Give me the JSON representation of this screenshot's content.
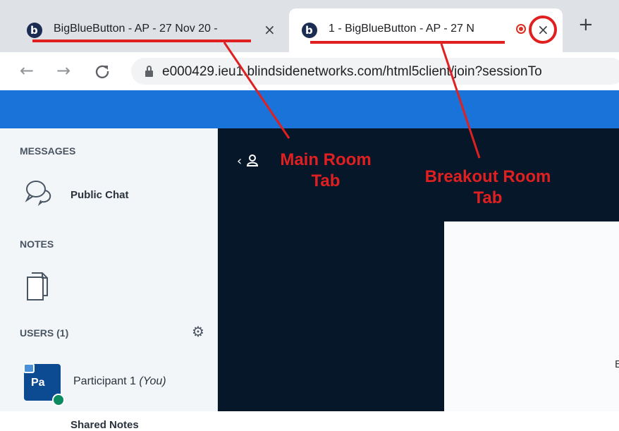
{
  "browser": {
    "tabs": [
      {
        "title": "BigBlueButton - AP - 27 Nov 20 -",
        "favicon": "bigbluebutton-icon",
        "close": "×"
      },
      {
        "title": "1 - BigBlueButton - AP - 27 N",
        "favicon": "bigbluebutton-icon",
        "close": "×",
        "recording_icon": "recording-dot-icon"
      }
    ],
    "new_tab": "+",
    "nav": {
      "back": "←",
      "forward": "→",
      "reload": "C"
    },
    "url": "e000429.ieu1.blindsidenetworks.com/html5client/join?sessionTo"
  },
  "sidebar": {
    "messages_header": "MESSAGES",
    "public_chat": "Public Chat",
    "notes_header": "NOTES",
    "shared_notes": "Shared Notes",
    "users_header": "USERS (1)",
    "participant": {
      "avatar_initials": "Pa",
      "name": "Participant 1",
      "you_label": "(You)"
    }
  },
  "main": {
    "back_icon": "‹",
    "slide_partial_text": "E"
  },
  "annotations": {
    "main_room_line1": "Main Room",
    "main_room_line2": "Tab",
    "breakout_line1": "Breakout Room",
    "breakout_line2": "Tab",
    "color": "#e02020"
  },
  "colors": {
    "header_blue": "#1a73d9",
    "presentation_bg": "#06172a",
    "sidebar_bg": "#f3f6f9"
  }
}
